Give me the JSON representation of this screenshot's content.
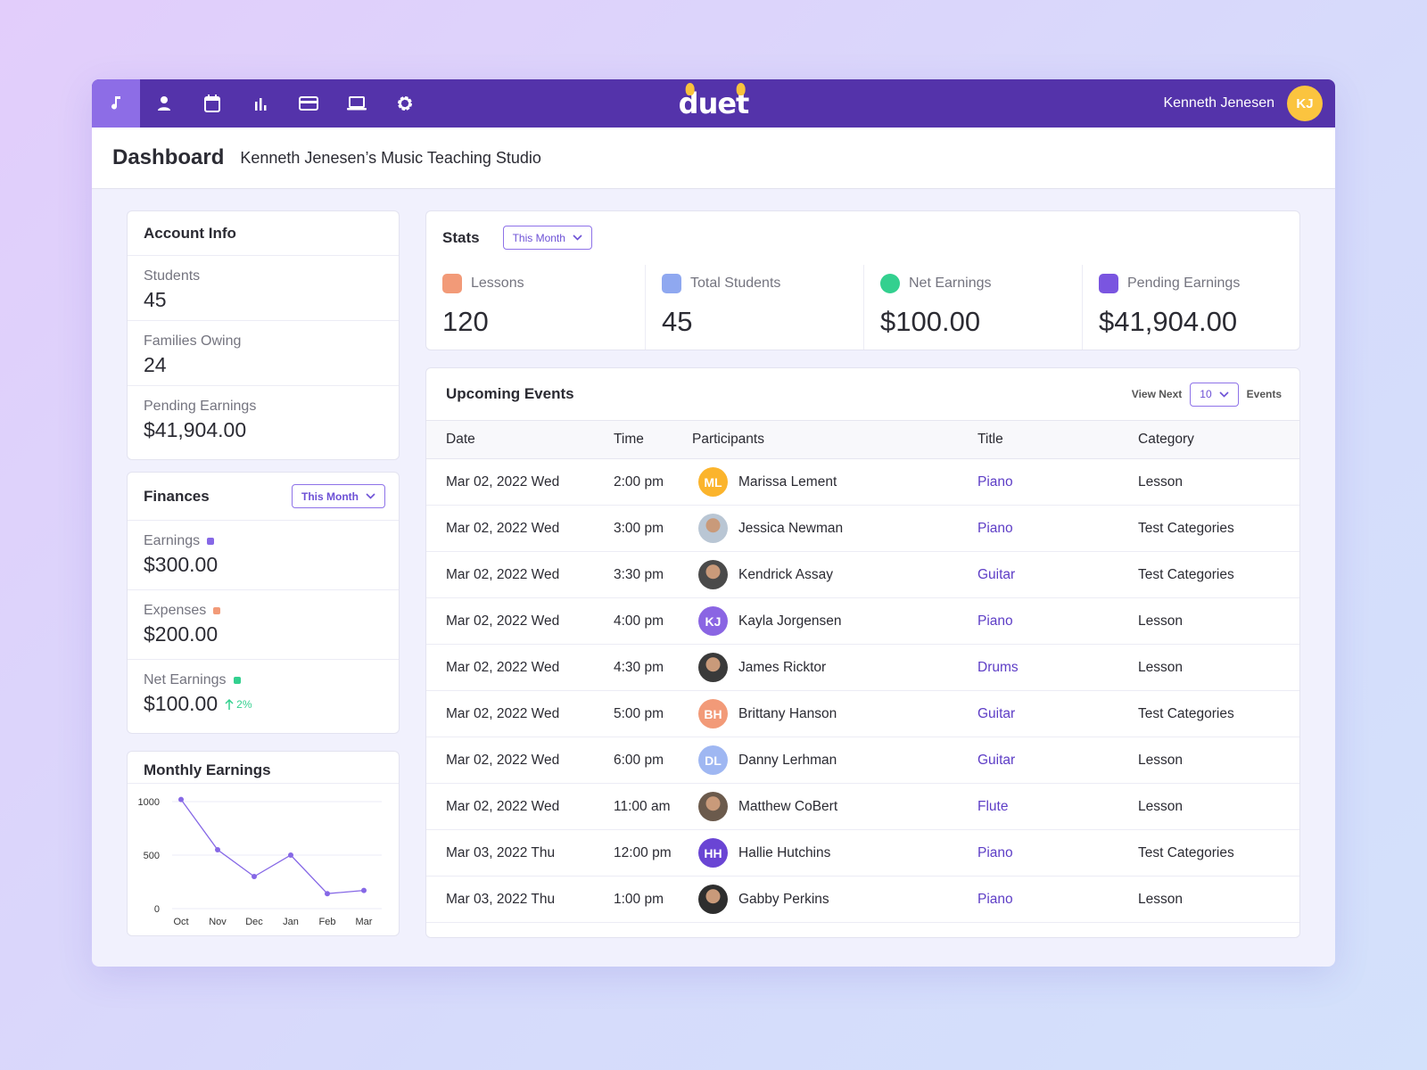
{
  "topbar": {
    "nav": [
      "music-note-icon",
      "user-icon",
      "calendar-icon",
      "bar-chart-icon",
      "credit-card-icon",
      "laptop-icon",
      "gear-icon"
    ],
    "logo": "duet",
    "user_name": "Kenneth Jenesen",
    "user_initials": "KJ"
  },
  "header": {
    "title": "Dashboard",
    "subtitle": "Kenneth Jenesen’s Music Teaching Studio"
  },
  "account": {
    "title": "Account Info",
    "items": [
      {
        "label": "Students",
        "value": "45"
      },
      {
        "label": "Families Owing",
        "value": "24"
      },
      {
        "label": "Pending Earnings",
        "value": "$41,904.00"
      }
    ]
  },
  "finances": {
    "title": "Finances",
    "filter": "This Month",
    "items": [
      {
        "label": "Earnings",
        "value": "$300.00",
        "color": "#8668e6"
      },
      {
        "label": "Expenses",
        "value": "$200.00",
        "color": "#f29a78"
      },
      {
        "label": "Net Earnings",
        "value": "$100.00",
        "color": "#33d08f",
        "change": "2%"
      }
    ]
  },
  "monthly": {
    "title": "Monthly Earnings"
  },
  "chart_data": {
    "type": "line",
    "categories": [
      "Oct",
      "Nov",
      "Dec",
      "Jan",
      "Feb",
      "Mar"
    ],
    "values": [
      1020,
      550,
      300,
      500,
      140,
      170
    ],
    "yticks": [
      "1000",
      "500",
      "0"
    ],
    "ylim": [
      0,
      1000
    ],
    "grid": true,
    "color": "#8668e6"
  },
  "stats": {
    "title": "Stats",
    "filter": "This Month",
    "items": [
      {
        "label": "Lessons",
        "value": "120",
        "icon": "lessons-icon",
        "color": "#f29a78"
      },
      {
        "label": "Total Students",
        "value": "45",
        "icon": "graduation-cap-icon",
        "color": "#8fa8f0"
      },
      {
        "label": "Net Earnings",
        "value": "$100.00",
        "icon": "dollar-icon",
        "color": "#33d08f"
      },
      {
        "label": "Pending Earnings",
        "value": "$41,904.00",
        "icon": "piggy-bank-icon",
        "color": "#7a55e0"
      }
    ]
  },
  "events": {
    "title": "Upcoming Events",
    "view_next": "View Next",
    "count": "10",
    "events_label": "Events",
    "columns": [
      "Date",
      "Time",
      "Participants",
      "Title",
      "Category"
    ],
    "rows": [
      {
        "date": "Mar 02, 2022 Wed",
        "time": "2:00 pm",
        "name": "Marissa Lement",
        "initials": "ML",
        "color": "#fbb42c",
        "title": "Piano",
        "category": "Lesson"
      },
      {
        "date": "Mar 02, 2022 Wed",
        "time": "3:00 pm",
        "name": "Jessica Newman",
        "initials": "",
        "color": "#b9c6d4",
        "title": "Piano",
        "category": "Test Categories"
      },
      {
        "date": "Mar 02, 2022 Wed",
        "time": "3:30 pm",
        "name": "Kendrick Assay",
        "initials": "",
        "color": "#4a4a4a",
        "title": "Guitar",
        "category": "Test Categories"
      },
      {
        "date": "Mar 02, 2022 Wed",
        "time": "4:00 pm",
        "name": "Kayla Jorgensen",
        "initials": "KJ",
        "color": "#8a65e3",
        "title": "Piano",
        "category": "Lesson"
      },
      {
        "date": "Mar 02, 2022 Wed",
        "time": "4:30 pm",
        "name": "James Ricktor",
        "initials": "",
        "color": "#3a3a3a",
        "title": "Drums",
        "category": "Lesson"
      },
      {
        "date": "Mar 02, 2022 Wed",
        "time": "5:00 pm",
        "name": "Brittany Hanson",
        "initials": "BH",
        "color": "#f29a78",
        "title": "Guitar",
        "category": "Test Categories"
      },
      {
        "date": "Mar 02, 2022 Wed",
        "time": "6:00 pm",
        "name": "Danny Lerhman",
        "initials": "DL",
        "color": "#9fb7f2",
        "title": "Guitar",
        "category": "Lesson"
      },
      {
        "date": "Mar 02, 2022 Wed",
        "time": "11:00 am",
        "name": "Matthew CoBert",
        "initials": "",
        "color": "#6b5a4c",
        "title": "Flute",
        "category": "Lesson"
      },
      {
        "date": "Mar 03, 2022 Thu",
        "time": "12:00 pm",
        "name": "Hallie Hutchins",
        "initials": "HH",
        "color": "#6a45d4",
        "title": "Piano",
        "category": "Test Categories"
      },
      {
        "date": "Mar 03, 2022 Thu",
        "time": "1:00 pm",
        "name": "Gabby Perkins",
        "initials": "",
        "color": "#2e2e2e",
        "title": "Piano",
        "category": "Lesson"
      }
    ]
  }
}
